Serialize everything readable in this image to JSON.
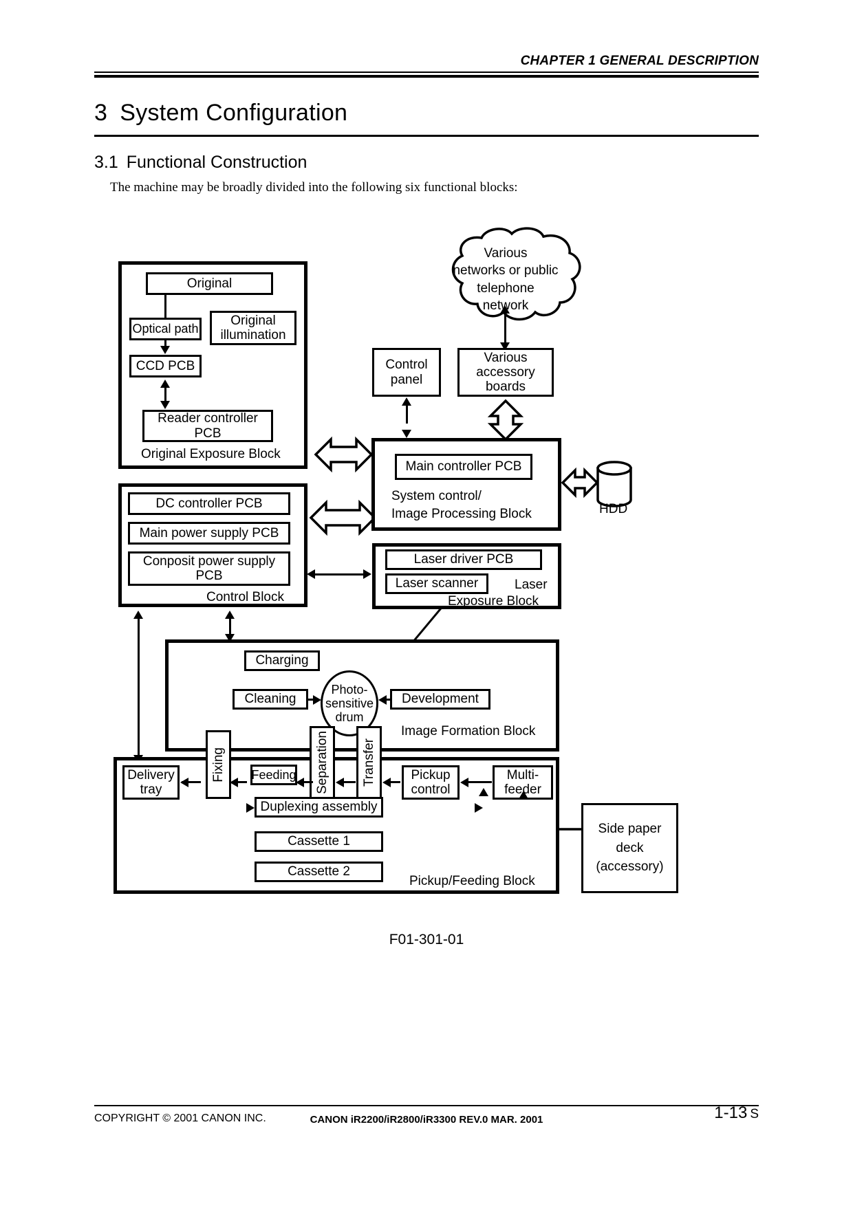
{
  "header": {
    "chapter": "CHAPTER 1 GENERAL DESCRIPTION"
  },
  "headings": {
    "section_number": "3",
    "section_title": "System Configuration",
    "subsection_number": "3.1",
    "subsection_title": "Functional Construction"
  },
  "intro": "The machine may be broadly divided into the following six functional blocks:",
  "figure": {
    "caption": "F01-301-01",
    "blocks": {
      "original_exposure": "Original Exposure Block",
      "system_control": "System control/",
      "system_control_2": "Image Processing Block",
      "control": "Control Block",
      "laser_exposure": "Laser",
      "laser_exposure_2": "Exposure Block",
      "image_formation": "Image Formation Block",
      "pickup_feeding": "Pickup/Feeding Block"
    },
    "nodes": {
      "original": "Original",
      "optical_path": "Optical path",
      "original_illumination": "Original",
      "original_illumination_2": "illumination",
      "ccd_pcb": "CCD PCB",
      "reader_controller": "Reader controller",
      "reader_controller_2": "PCB",
      "cloud": "Various\nnetworks or public\ntelephone\nnetwork",
      "cloud_l1": "Various",
      "cloud_l2": "networks or public",
      "cloud_l3": "telephone",
      "cloud_l4": "network",
      "control_panel": "Control",
      "control_panel_2": "panel",
      "accessory_boards": "Various",
      "accessory_boards_2": "accessory",
      "accessory_boards_3": "boards",
      "main_controller": "Main controller PCB",
      "hdd": "HDD",
      "dc_controller": "DC controller PCB",
      "main_power": "Main power supply PCB",
      "composit_power": "Conposit power supply",
      "composit_power_2": "PCB",
      "laser_driver": "Laser driver PCB",
      "laser_scanner": "Laser scanner",
      "charging": "Charging",
      "cleaning": "Cleaning",
      "development": "Development",
      "drum": "Photo-",
      "drum_2": "sensitive",
      "drum_3": "drum",
      "fixing": "Fixing",
      "separation": "Separation",
      "transfer": "Transfer",
      "feeding": "Feeding",
      "delivery_tray": "Delivery",
      "delivery_tray_2": "tray",
      "duplexing": "Duplexing assembly",
      "cassette1": "Cassette 1",
      "cassette2": "Cassette 2",
      "pickup_control": "Pickup",
      "pickup_control_2": "control",
      "multifeeder": "Multi-",
      "multifeeder_2": "feeder",
      "side_deck": "Side paper",
      "side_deck_2": "deck",
      "side_deck_3": "(accessory)"
    }
  },
  "footer": {
    "copyright": "COPYRIGHT © 2001 CANON INC.",
    "center": "CANON iR2200/iR2800/iR3300 REV.0 MAR. 2001",
    "page": "1-13",
    "page_suffix": "S"
  },
  "colors": {
    "ink": "#000000",
    "paper": "#ffffff"
  }
}
